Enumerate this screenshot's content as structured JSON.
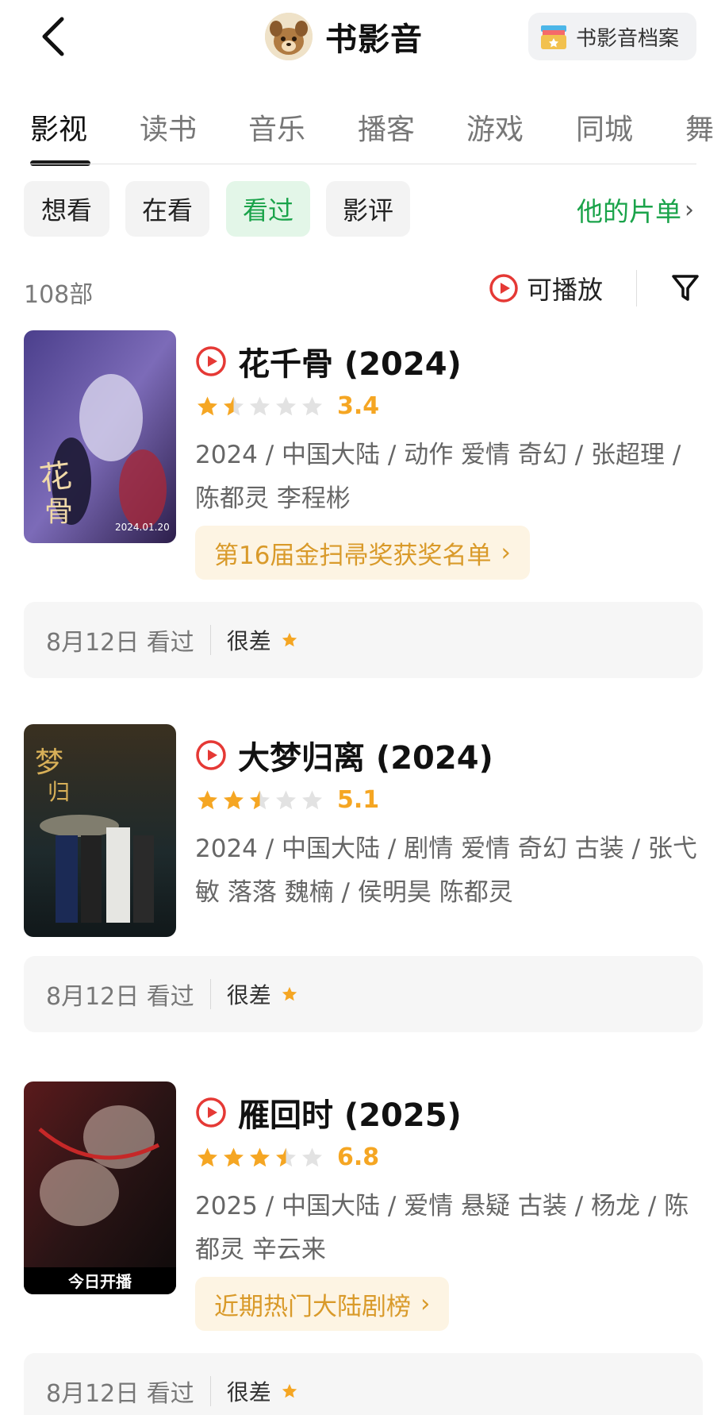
{
  "header": {
    "title": "书影音",
    "archive_label": "书影音档案"
  },
  "tabs": [
    {
      "label": "影视",
      "active": true
    },
    {
      "label": "读书"
    },
    {
      "label": "音乐"
    },
    {
      "label": "播客"
    },
    {
      "label": "游戏"
    },
    {
      "label": "同城"
    },
    {
      "label": "舞"
    }
  ],
  "filters": [
    {
      "label": "想看"
    },
    {
      "label": "在看"
    },
    {
      "label": "看过",
      "active": true
    },
    {
      "label": "影评"
    }
  ],
  "list_link": "他的片单",
  "count": "108部",
  "playable_label": "可播放",
  "colors": {
    "accent_green": "#1aa34a",
    "star_gold": "#f5a623",
    "play_red": "#e53935"
  },
  "items": [
    {
      "title": "花千骨 (2024)",
      "stars": 1.5,
      "score": "3.4",
      "meta": "2024 / 中国大陆 / 动作 爱情 奇幻 / 张超理 / 陈都灵 李程彬",
      "badge": "第16届金扫帚奖获奖名单",
      "poster_date": "2024.01.20",
      "review_date": "8月12日 看过",
      "review_label": "很差"
    },
    {
      "title": "大梦归离 (2024)",
      "stars": 2.5,
      "score": "5.1",
      "meta": "2024 / 中国大陆 / 剧情 爱情 奇幻 古装 / 张弋敏 落落 魏楠 / 侯明昊 陈都灵",
      "badge": "",
      "review_date": "8月12日 看过",
      "review_label": "很差"
    },
    {
      "title": "雁回时 (2025)",
      "stars": 3.5,
      "score": "6.8",
      "meta": "2025 / 中国大陆 / 爱情 悬疑 古装 / 杨龙 / 陈都灵 辛云来",
      "badge": "近期热门大陆剧榜",
      "poster_caption": "今日开播",
      "review_date": "8月12日 看过",
      "review_label": "很差"
    }
  ]
}
